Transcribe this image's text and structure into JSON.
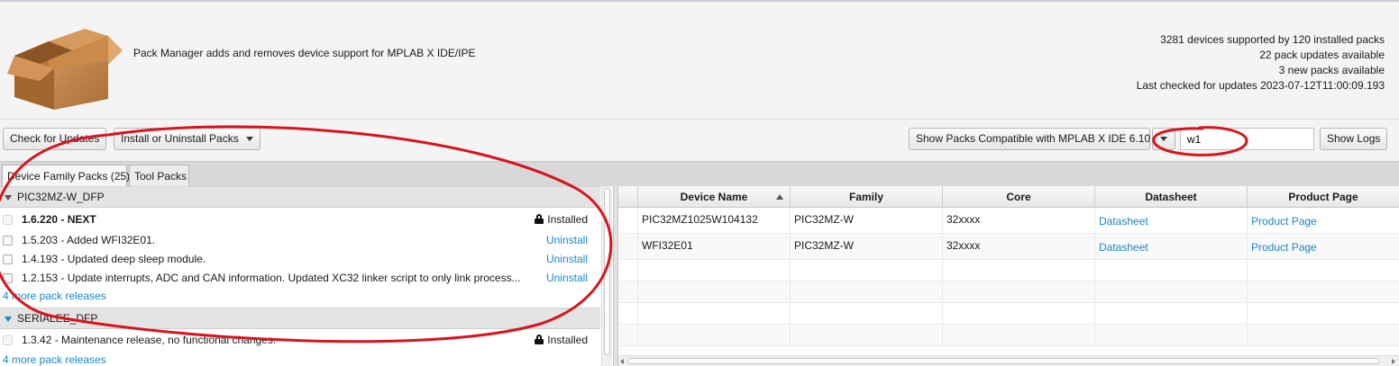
{
  "header": {
    "description": "Pack Manager adds and removes device support for MPLAB X IDE/IPE",
    "stats": [
      "3281 devices supported by 120 installed packs",
      "22 pack updates available",
      "3 new packs available",
      "Last checked for updates 2023-07-12T11:00:09.193"
    ]
  },
  "toolbar": {
    "check_updates": "Check for Updates",
    "install_uninstall": "Install or Uninstall Packs",
    "compat_filter": "Show Packs Compatible with MPLAB X IDE 6.10",
    "search_value": "w1",
    "show_logs": "Show Logs"
  },
  "tabs": [
    "Device Family Packs (25)",
    "Tool Packs"
  ],
  "packs": [
    {
      "name": "PIC32MZ-W_DFP",
      "releases": [
        {
          "label": "1.6.220 - NEXT",
          "action": "Installed",
          "bold": true
        },
        {
          "label": "1.5.203 - Added WFI32E01.",
          "action": "Uninstall"
        },
        {
          "label": "1.4.193 - Updated deep sleep module.",
          "action": "Uninstall"
        },
        {
          "label": "1.2.153 - Update interrupts, ADC and CAN information. Updated XC32 linker script to only link process...",
          "action": "Uninstall"
        }
      ],
      "more": "4 more pack releases"
    },
    {
      "name": "SERIALEE_DFP",
      "releases": [
        {
          "label": "1.3.42 - Maintenance release, no functional changes.",
          "action": "Installed"
        }
      ],
      "more": "4 more pack releases"
    }
  ],
  "table": {
    "columns": [
      "Device Name",
      "Family",
      "Core",
      "Datasheet",
      "Product Page"
    ],
    "rows": [
      [
        "PIC32MZ1025W104132",
        "PIC32MZ-W",
        "32xxxx",
        "Datasheet",
        "Product Page"
      ],
      [
        "WFI32E01",
        "PIC32MZ-W",
        "32xxxx",
        "Datasheet",
        "Product Page"
      ]
    ]
  },
  "colors": {
    "link": "#1a87c8",
    "annotation": "#d8141c"
  }
}
